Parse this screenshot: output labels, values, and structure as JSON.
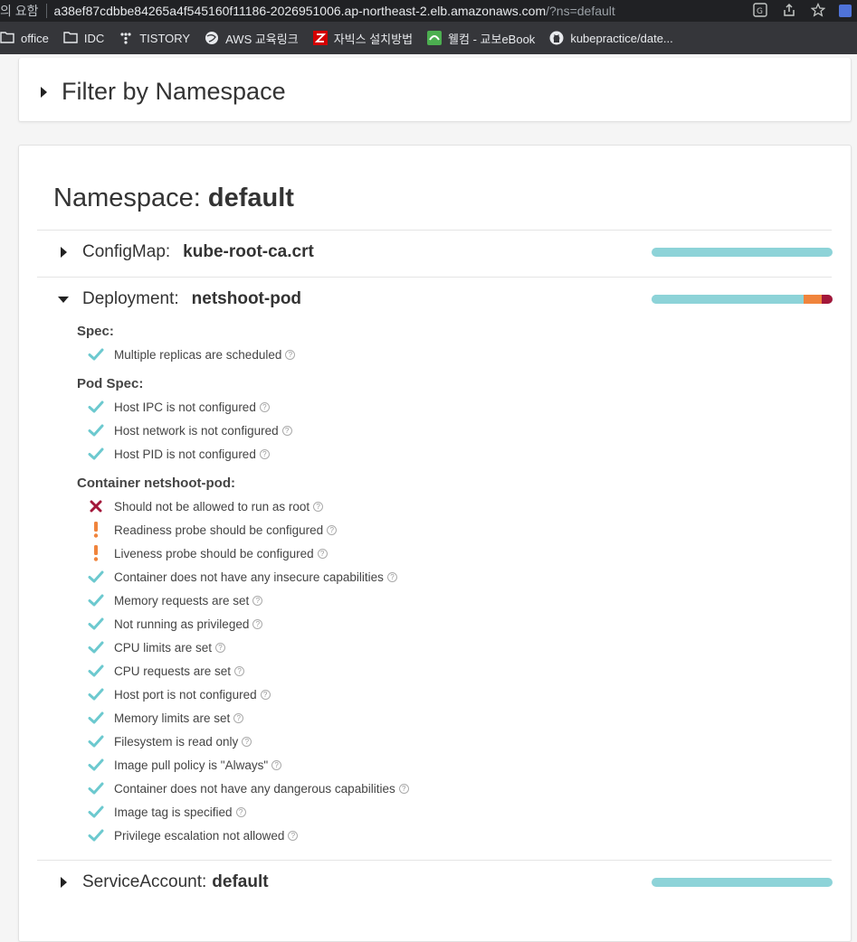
{
  "browser": {
    "address_left": "의 요함",
    "url_host": "a38ef87cdbbe84265a4f545160f11186-2026951006.ap-northeast-2.elb.amazonaws.com",
    "url_query": "/?ns=default",
    "bookmarks": [
      {
        "label": "office",
        "icon": "folder-icon"
      },
      {
        "label": "IDC",
        "icon": "folder-icon"
      },
      {
        "label": "TISTORY",
        "icon": "tistory-icon"
      },
      {
        "label": "AWS 교육링크",
        "icon": "globe-icon"
      },
      {
        "label": "자빅스 설치방법",
        "icon": "zabbix-icon"
      },
      {
        "label": "웰컴 - 교보eBook",
        "icon": "kyobo-icon"
      },
      {
        "label": "kubepractice/date...",
        "icon": "github-icon"
      }
    ]
  },
  "filter": {
    "title": "Filter by Namespace"
  },
  "namespace": {
    "label": "Namespace:",
    "name": "default"
  },
  "resources": [
    {
      "kind": "ConfigMap:",
      "name": "kube-root-ca.crt",
      "expanded": false,
      "score": {
        "pass": 1.0,
        "warning": 0.0,
        "danger": 0.0
      }
    },
    {
      "kind": "Deployment:",
      "name": "netshoot-pod",
      "expanded": true,
      "score": {
        "pass": 0.84,
        "warning": 0.1,
        "danger": 0.06
      },
      "sections": [
        {
          "title": "Spec:",
          "checks": [
            {
              "status": "pass",
              "text": "Multiple replicas are scheduled"
            }
          ]
        },
        {
          "title": "Pod Spec:",
          "checks": [
            {
              "status": "pass",
              "text": "Host IPC is not configured"
            },
            {
              "status": "pass",
              "text": "Host network is not configured"
            },
            {
              "status": "pass",
              "text": "Host PID is not configured"
            }
          ]
        },
        {
          "title": "Container netshoot-pod:",
          "checks": [
            {
              "status": "danger",
              "text": "Should not be allowed to run as root"
            },
            {
              "status": "warning",
              "text": "Readiness probe should be configured"
            },
            {
              "status": "warning",
              "text": "Liveness probe should be configured"
            },
            {
              "status": "pass",
              "text": "Container does not have any insecure capabilities"
            },
            {
              "status": "pass",
              "text": "Memory requests are set"
            },
            {
              "status": "pass",
              "text": "Not running as privileged"
            },
            {
              "status": "pass",
              "text": "CPU limits are set"
            },
            {
              "status": "pass",
              "text": "CPU requests are set"
            },
            {
              "status": "pass",
              "text": "Host port is not configured"
            },
            {
              "status": "pass",
              "text": "Memory limits are set"
            },
            {
              "status": "pass",
              "text": "Filesystem is read only"
            },
            {
              "status": "pass",
              "text": "Image pull policy is \"Always\""
            },
            {
              "status": "pass",
              "text": "Container does not have any dangerous capabilities"
            },
            {
              "status": "pass",
              "text": "Image tag is specified"
            },
            {
              "status": "pass",
              "text": "Privilege escalation not allowed"
            }
          ]
        }
      ]
    },
    {
      "kind": "ServiceAccount:",
      "name": "default",
      "expanded": false,
      "score": {
        "pass": 1.0,
        "warning": 0.0,
        "danger": 0.0
      }
    }
  ],
  "colors": {
    "pass": "#6cc9cf",
    "warning": "#f0843c",
    "danger": "#a3173a",
    "bar_pass": "#8dd3d8"
  },
  "icons": {
    "pass": "check-icon",
    "warning": "exclamation-icon",
    "danger": "x-icon",
    "help": "question-circle-icon"
  }
}
